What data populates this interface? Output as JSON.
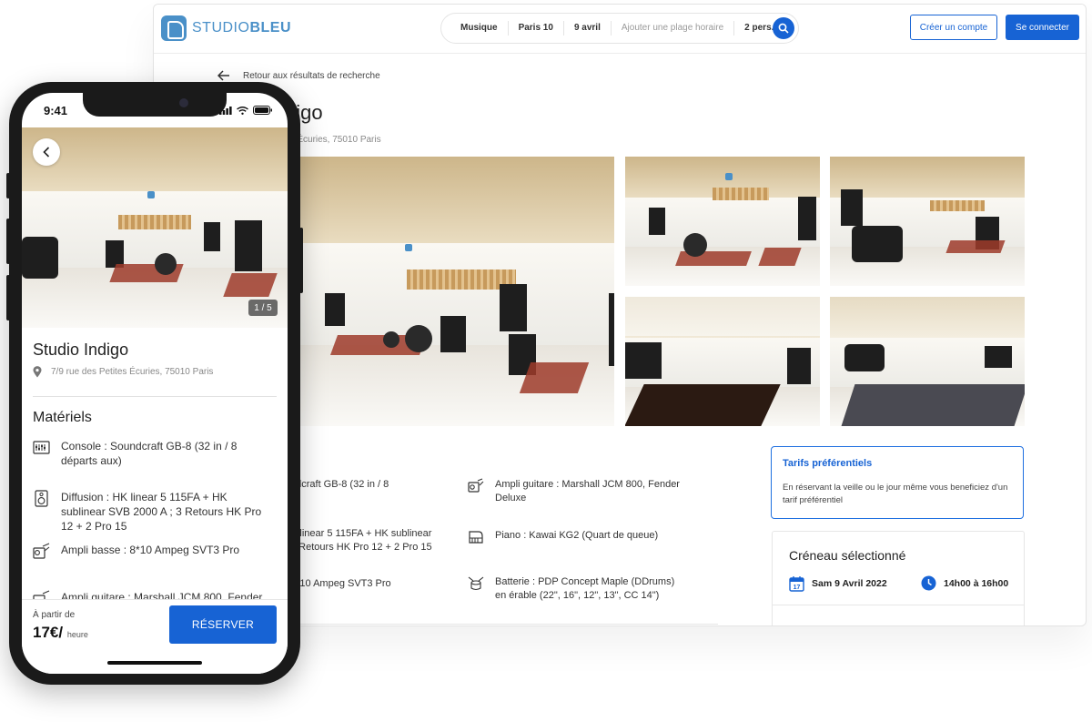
{
  "brand": {
    "name_light": "STUDIO",
    "name_bold": "BLEU",
    "color": "#4a90c8"
  },
  "search": {
    "category": "Musique",
    "location": "Paris 10",
    "date": "9 avril",
    "time_placeholder": "Ajouter une plage horaire",
    "people": "2 pers."
  },
  "header": {
    "signup": "Créer un compte",
    "login": "Se connecter"
  },
  "accent": "#1763d4",
  "desktop": {
    "back_label": "Retour aux résultats de recherche",
    "title_visible": "digo",
    "address_visible": "es Écuries, 75010 Paris",
    "equipment_left": [
      "ndcraft GB-8 (32 in / 8",
      "K linear 5 115FA + HK sublinear\n8 Retours HK Pro 12 + 2 Pro 15",
      "8*10 Ampeg SVT3 Pro"
    ],
    "equipment_right": [
      "Ampli guitare : Marshall JCM 800, Fender Deluxe",
      "Piano : Kawai KG2 (Quart de queue)",
      "Batterie : PDP Concept Maple (DDrums) en érable (22\", 16\", 12\", 13\", CC 14\")"
    ],
    "tarifs": {
      "title": "Tarifs préférentiels",
      "text": "En réservant la veille ou le jour même vous beneficiez d'un tarif préférentiel"
    },
    "slot": {
      "title": "Créneau sélectionné",
      "date": "Sam 9 Avril 2022",
      "calendar_day": "17",
      "time": "14h00 à 16h00"
    }
  },
  "phone": {
    "status_time": "9:41",
    "photo_counter": "1 / 5",
    "title": "Studio Indigo",
    "address": "7/9 rue des Petites Écuries, 75010 Paris",
    "section": "Matériels",
    "equipment": [
      "Console : Soundcraft GB-8 (32 in / 8 départs aux)",
      "Diffusion : HK linear 5 115FA + HK sublinear SVB 2000 A ; 3 Retours HK Pro 12 + 2 Pro 15",
      "Ampli basse : 8*10 Ampeg SVT3 Pro",
      "Ampli guitare : Marshall JCM 800, Fender"
    ],
    "from_label": "À partir de",
    "price": "17€/",
    "price_unit": "heure",
    "reserve": "RÉSERVER"
  }
}
